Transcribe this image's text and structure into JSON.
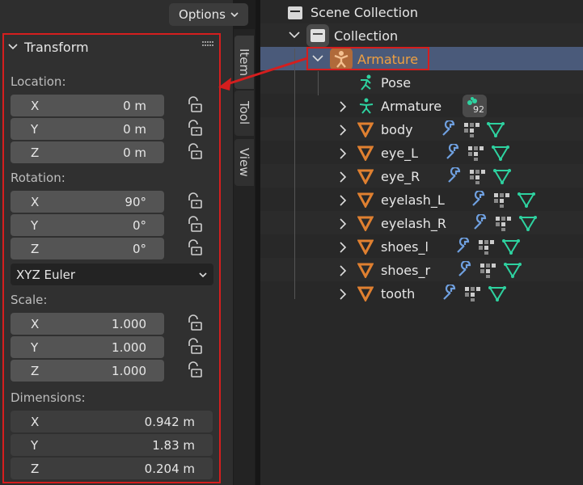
{
  "header": {
    "options_label": "Options"
  },
  "panel": {
    "title": "Transform",
    "location": {
      "label": "Location:",
      "x": "0 m",
      "y": "0 m",
      "z": "0 m"
    },
    "rotation": {
      "label": "Rotation:",
      "x": "90°",
      "y": "0°",
      "z": "0°",
      "mode": "XYZ Euler"
    },
    "scale": {
      "label": "Scale:",
      "x": "1.000",
      "y": "1.000",
      "z": "1.000"
    },
    "dimensions": {
      "label": "Dimensions:",
      "x": "0.942 m",
      "y": "1.83 m",
      "z": "0.204 m"
    },
    "axis": {
      "x": "X",
      "y": "Y",
      "z": "Z"
    }
  },
  "tabs": [
    "Item",
    "Tool",
    "View"
  ],
  "outliner": {
    "scene_collection": "Scene Collection",
    "collection": "Collection",
    "armature": "Armature",
    "pose": "Pose",
    "armature_data": "Armature",
    "armature_data_users": "92",
    "objects": [
      "body",
      "eye_L",
      "eye_R",
      "eyelash_L",
      "eyelash_R",
      "shoes_l",
      "shoes_r",
      "tooth"
    ]
  },
  "colors": {
    "highlight": "#d51e1e",
    "selected_row": "#4a5a7a",
    "armature_text": "#f0a040",
    "mesh": "#e08030",
    "modifier": "#6fa0e0",
    "data": "#2ed2a0"
  }
}
